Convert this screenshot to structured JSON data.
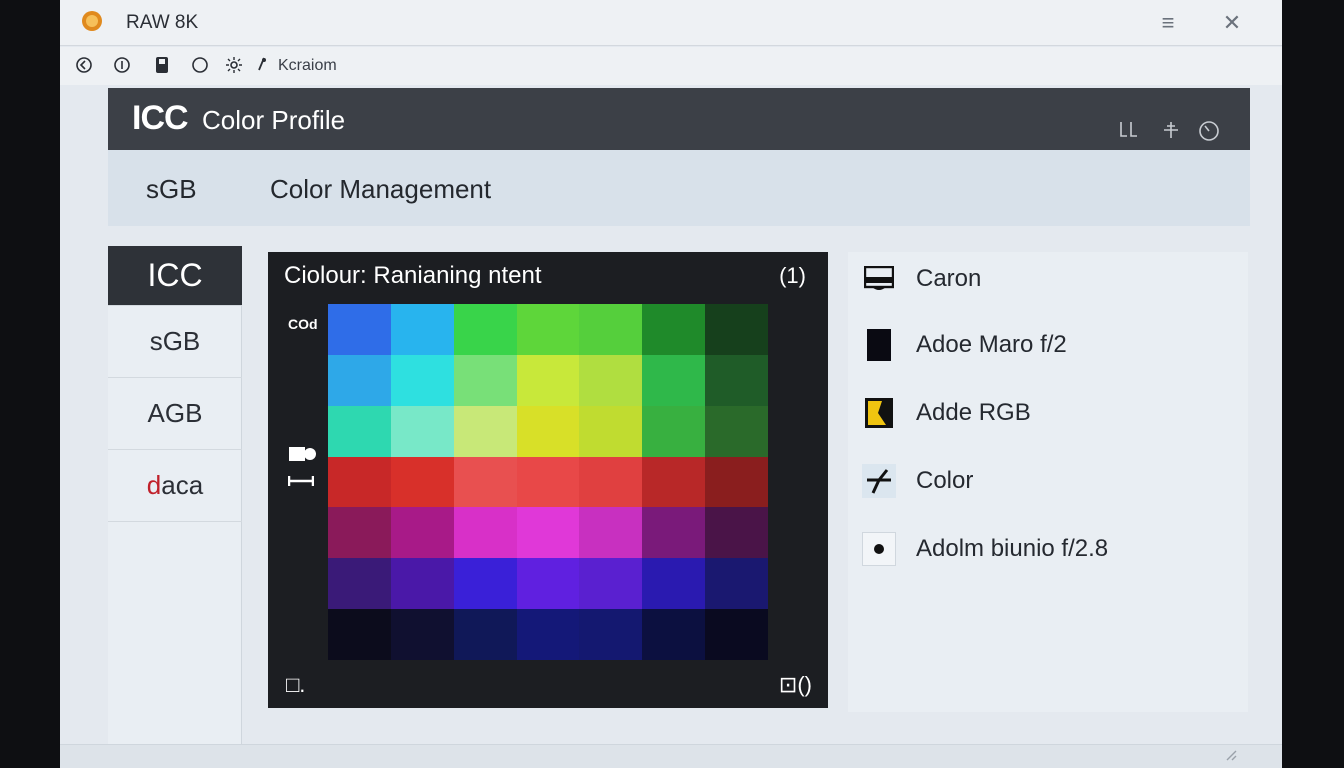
{
  "window": {
    "title": "RAW 8K",
    "controls": [
      "≡",
      "✕"
    ]
  },
  "toolbar": {
    "icons": [
      "back-icon",
      "info-icon",
      "save-icon",
      "circle-icon",
      "settings-icon",
      "pin-icon"
    ],
    "label": "Kcraiom"
  },
  "panel": {
    "icc_badge": "ICC",
    "title": "Color Profile",
    "header_icons": [
      "layout-icon",
      "adjust-icon",
      "timer-icon"
    ]
  },
  "subheader": {
    "left": "sGB",
    "right": "Color Management"
  },
  "nav": {
    "items": [
      {
        "label": "ICC",
        "active": true
      },
      {
        "label": "sGB",
        "active": false
      },
      {
        "label": "AGB",
        "active": false
      },
      {
        "label": "daca",
        "active": false
      }
    ]
  },
  "viewer": {
    "title": "Ciolour: Ranianing ntent",
    "count": "(1)",
    "side_label": "COd",
    "footer_left": "□.",
    "footer_right": "⊡()",
    "swatches": [
      [
        "#2f6de8",
        "#28b4ee",
        "#39d44a",
        "#5ed63a",
        "#55cf3c",
        "#1f8a2a",
        "#16401c"
      ],
      [
        "#2ea8e8",
        "#2ee0e0",
        "#78e078",
        "#c8e83a",
        "#b0de40",
        "#2fb84a",
        "#1f5c28"
      ],
      [
        "#2ed8b0",
        "#78e8c8",
        "#c8e878",
        "#d8e028",
        "#c0dc30",
        "#38b040",
        "#2a6a2a"
      ],
      [
        "#c82828",
        "#d8302a",
        "#e85050",
        "#e84848",
        "#e04040",
        "#b82828",
        "#8a1e1e"
      ],
      [
        "#8a1a5a",
        "#a81a88",
        "#d830c8",
        "#e038d8",
        "#c830c0",
        "#7a1a7a",
        "#4a1448"
      ],
      [
        "#3a1a78",
        "#4a18a8",
        "#3a20d8",
        "#6020e0",
        "#5a20d0",
        "#2a1ab0",
        "#1a1870"
      ]
    ],
    "shadow_row": [
      "#0c0c1c",
      "#101030",
      "#101858",
      "#141878",
      "#141870",
      "#0c1040",
      "#0a0a20"
    ]
  },
  "profiles": {
    "items": [
      {
        "label": "Caron",
        "icon": "printer-icon"
      },
      {
        "label": "Adoe Maro f/2",
        "icon": "black-square-icon"
      },
      {
        "label": "Adde RGB",
        "icon": "yellow-flag-icon"
      },
      {
        "label": "Color",
        "icon": "plane-icon"
      },
      {
        "label": "Adolm biunio f/2.8",
        "icon": "dot-icon"
      }
    ]
  },
  "colors": {
    "header_bg": "#3c4047",
    "viewer_bg": "#1c1e22",
    "nav_active_bg": "#2e3238",
    "flag_yellow": "#f0c410"
  }
}
